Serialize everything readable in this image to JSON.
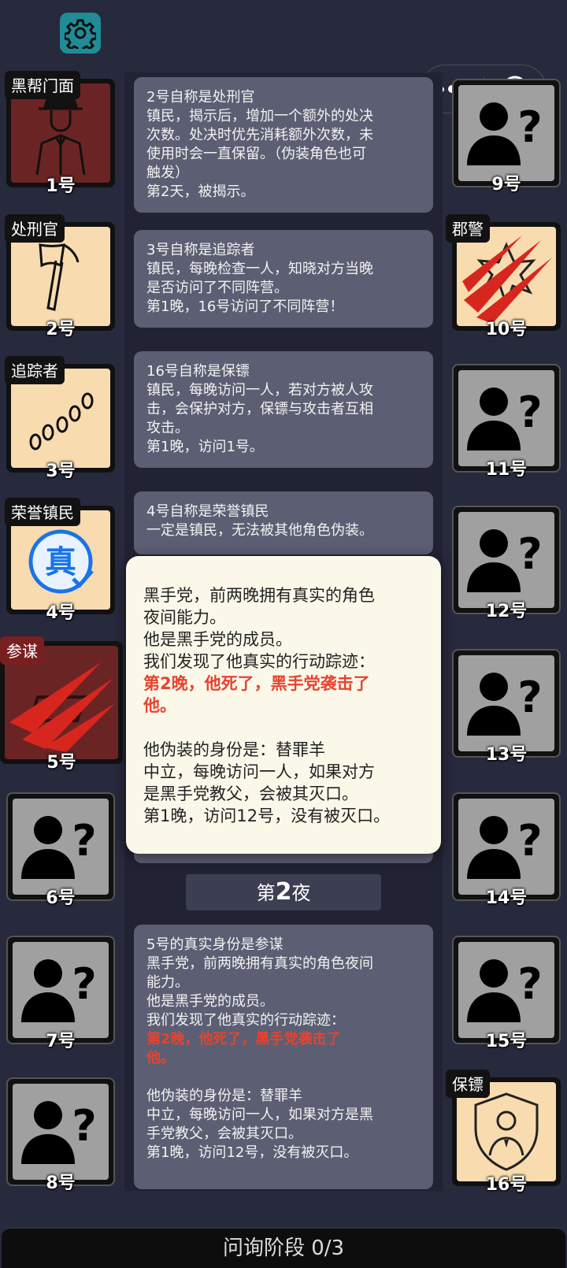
{
  "capsule": {
    "more_icon": "more-dots-icon",
    "close_icon": "target-icon"
  },
  "cards": [
    {
      "claim": "2号自称是处刑官",
      "lines": [
        "镇民，揭示后，增加一个额外的处决",
        "次数。处决时优先消耗额外次数，未",
        "使用时会一直保留。（伪装角色也可",
        "触发）",
        "第2天，被揭示。"
      ]
    },
    {
      "claim": "3号自称是追踪者",
      "lines": [
        "镇民，每晚检查一人，知晓对方当晚",
        "是否访问了不同阵营。",
        "第1晚，16号访问了不同阵营！"
      ]
    },
    {
      "claim": "16号自称是保镖",
      "lines": [
        "镇民，每晚访问一人，若对方被人攻",
        "击，会保护对方，保镖与攻击者互相",
        "攻击。",
        "第1晚，访问1号。"
      ]
    },
    {
      "claim": "4号自称是荣誉镇民",
      "lines": [
        "一定是镇民，无法被其他角色伪装。"
      ]
    }
  ],
  "popup": {
    "lines": [
      "黑手党，前两晚拥有真实的角色",
      "夜间能力。",
      "他是黑手党的成员。",
      "我们发现了他真实的行动踪迹："
    ],
    "red_lines": [
      "第2晚，他死了，黑手党袭击了",
      "他。"
    ],
    "disguise_lines": [
      "他伪装的身份是：替罪羊",
      "中立，每晚访问一人，如果对方",
      "是黑手党教父，会被其灭口。",
      "第1晚，访问12号，没有被灭口。"
    ]
  },
  "night": {
    "prefix": "第",
    "number": "2",
    "suffix": "夜"
  },
  "card5": {
    "claim": "5号的真实身份是参谋",
    "lines": [
      "黑手党，前两晚拥有真实的角色夜间",
      "能力。",
      "他是黑手党的成员。",
      "我们发现了他真实的行动踪迹："
    ],
    "red_lines": [
      "第2晚，他死了，黑手党袭击了",
      "他。"
    ],
    "disguise_lines": [
      "他伪装的身份是：替罪羊",
      "中立，每晚访问一人，如果对方是黑",
      "手党教父，会被其灭口。",
      "第1晚，访问12号，没有被灭口。"
    ]
  },
  "players_left": [
    {
      "num": "1号",
      "tag": "黑帮门面",
      "icon": "mobster-icon",
      "state": "dead"
    },
    {
      "num": "2号",
      "tag": "处刑官",
      "icon": "axe-icon",
      "state": "known"
    },
    {
      "num": "3号",
      "tag": "追踪者",
      "icon": "footprints-icon",
      "state": "known"
    },
    {
      "num": "4号",
      "tag": "荣誉镇民",
      "icon": "true-badge-icon",
      "badge": "真",
      "state": "known"
    },
    {
      "num": "5号",
      "tag": "参谋",
      "icon": "claw-scratch-icon",
      "state": "dead"
    },
    {
      "num": "6号",
      "icon": "unknown-person-icon",
      "state": "unknown"
    },
    {
      "num": "7号",
      "icon": "unknown-person-icon",
      "state": "unknown"
    },
    {
      "num": "8号",
      "icon": "unknown-person-icon",
      "state": "unknown"
    }
  ],
  "players_right": [
    {
      "num": "9号",
      "icon": "unknown-person-icon",
      "state": "unknown"
    },
    {
      "num": "10号",
      "tag": "郡警",
      "icon": "sheriff-star-icon",
      "state": "known"
    },
    {
      "num": "11号",
      "icon": "unknown-person-icon",
      "state": "unknown"
    },
    {
      "num": "12号",
      "icon": "unknown-person-icon",
      "state": "unknown"
    },
    {
      "num": "13号",
      "icon": "unknown-person-icon",
      "state": "unknown"
    },
    {
      "num": "14号",
      "icon": "unknown-person-icon",
      "state": "unknown"
    },
    {
      "num": "15号",
      "icon": "unknown-person-icon",
      "state": "unknown"
    },
    {
      "num": "16号",
      "tag": "保镖",
      "icon": "bodyguard-shield-icon",
      "state": "known"
    }
  ],
  "bottom": {
    "phase": "问询阶段 0/3"
  },
  "colors": {
    "background": "#27293d",
    "card": "#5c5f73",
    "accent_red": "#e8432f",
    "gear": "#1f8c97",
    "known_tile": "#f9dbb0"
  }
}
